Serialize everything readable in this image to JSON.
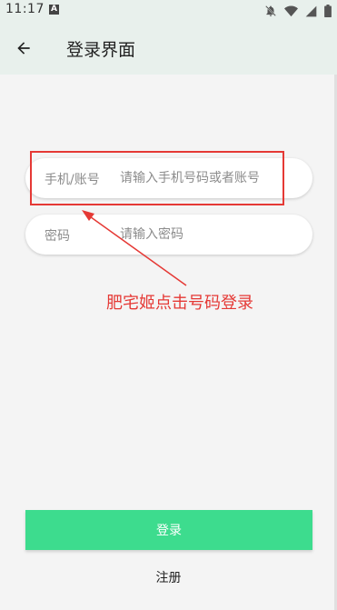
{
  "status_bar": {
    "time": "11:17",
    "notification_badge": "A",
    "icons": [
      "bell-off-icon",
      "wifi-icon",
      "signal-icon",
      "battery-icon"
    ]
  },
  "app_bar": {
    "title": "登录界面",
    "back_icon": "arrow-left-icon"
  },
  "account_field": {
    "label": "手机/账号",
    "placeholder": "请输入手机号码或者账号",
    "value": ""
  },
  "password_field": {
    "label": "密码",
    "placeholder": "请输入密码",
    "value": ""
  },
  "annotation": {
    "text": "肥宅姬点击号码登录",
    "color": "#e53935"
  },
  "login_button": {
    "label": "登录",
    "color": "#3ddc8e"
  },
  "register_link": {
    "label": "注册"
  },
  "colors": {
    "app_bar_bg": "#e8f0ec",
    "page_bg": "#f4f4f4"
  }
}
